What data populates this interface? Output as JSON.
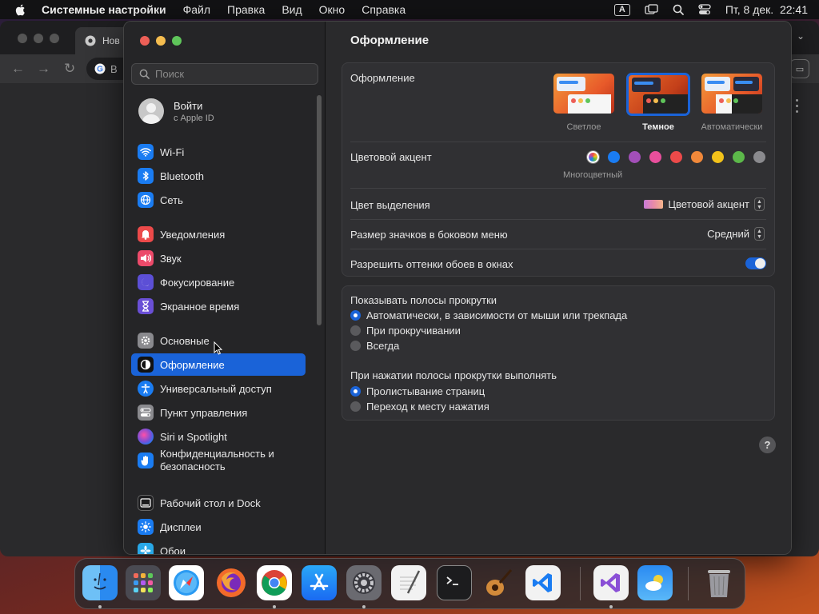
{
  "menubar": {
    "app_name": "Системные настройки",
    "menus": [
      "Файл",
      "Правка",
      "Вид",
      "Окно",
      "Справка"
    ],
    "input_source": "A",
    "datetime": "Пт, 8 дек.  22:41"
  },
  "browser": {
    "tab_title": "Нов",
    "omnibox_text": "В"
  },
  "sidebar": {
    "search_placeholder": "Поиск",
    "account": {
      "title": "Войти",
      "subtitle": "с Apple ID"
    },
    "items": [
      {
        "label": "Wi-Fi",
        "icon": "wifi-icon",
        "color": "#1a7cf2"
      },
      {
        "label": "Bluetooth",
        "icon": "bluetooth-icon",
        "color": "#1a7cf2"
      },
      {
        "label": "Сеть",
        "icon": "globe-icon",
        "color": "#1a7cf2"
      },
      {
        "label": "Уведомления",
        "icon": "bell-icon",
        "color": "#ec4a4a"
      },
      {
        "label": "Звук",
        "icon": "speaker-icon",
        "color": "#ec4a6a"
      },
      {
        "label": "Фокусирование",
        "icon": "moon-icon",
        "color": "#5c4fd6"
      },
      {
        "label": "Экранное время",
        "icon": "hourglass-icon",
        "color": "#6a4fd6"
      },
      {
        "label": "Основные",
        "icon": "gear-icon",
        "color": "#8a8a8e"
      },
      {
        "label": "Оформление",
        "icon": "appearance-icon",
        "color": "#111111"
      },
      {
        "label": "Универсальный доступ",
        "icon": "accessibility-icon",
        "color": "#1a7cf2"
      },
      {
        "label": "Пункт управления",
        "icon": "control-center-icon",
        "color": "#8a8a8e"
      },
      {
        "label": "Siri и Spotlight",
        "icon": "siri-icon",
        "color": "#7a4fd6"
      },
      {
        "label": "Конфиденциальность и безопасность",
        "icon": "hand-icon",
        "color": "#1a7cf2"
      },
      {
        "label": "Рабочий стол и Dock",
        "icon": "desktop-icon",
        "color": "#1c1c1e"
      },
      {
        "label": "Дисплеи",
        "icon": "sun-icon",
        "color": "#1a7cf2"
      },
      {
        "label": "Обои",
        "icon": "wallpaper-icon",
        "color": "#28a8e8"
      }
    ]
  },
  "content": {
    "title": "Оформление",
    "appearance_label": "Оформление",
    "appearance_options": [
      "Светлое",
      "Темное",
      "Автоматически"
    ],
    "appearance_selected": "Темное",
    "accent_label": "Цветовой акцент",
    "accent_colors": [
      "#1a7cf2",
      "#a24fb8",
      "#e84f9c",
      "#ec4a4a",
      "#f0883a",
      "#f2c21a",
      "#5cb84a",
      "#8a8a8e"
    ],
    "accent_selected_caption": "Многоцветный",
    "highlight_label": "Цвет выделения",
    "highlight_value": "Цветовой акцент",
    "icon_size_label": "Размер значков в боковом меню",
    "icon_size_value": "Средний",
    "wallpaper_tint_label": "Разрешить оттенки обоев в окнах",
    "wallpaper_tint_on": true,
    "scroll_section_title": "Показывать полосы прокрутки",
    "scroll_options": [
      "Автоматически, в зависимости от мыши или трекпада",
      "При прокручивании",
      "Всегда"
    ],
    "scroll_selected": 0,
    "click_section_title": "При нажатии полосы прокрутки выполнять",
    "click_options": [
      "Пролистывание страниц",
      "Переход к месту нажатия"
    ],
    "click_selected": 0,
    "help_label": "?"
  },
  "dock": [
    "finder-icon",
    "launchpad-icon",
    "safari-icon",
    "firefox-icon",
    "chrome-icon",
    "app-store-icon",
    "system-settings-icon",
    "textedit-icon",
    "terminal-icon",
    "garageband-icon",
    "vscode-icon",
    "visual-studio-icon",
    "weather-icon",
    "trash-icon"
  ]
}
